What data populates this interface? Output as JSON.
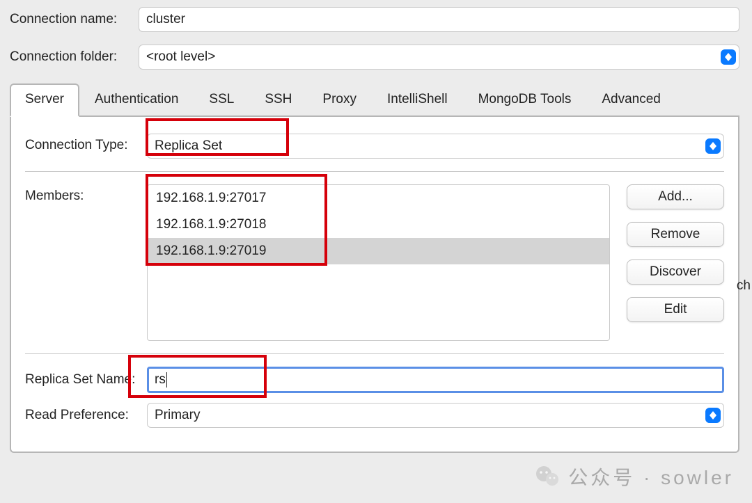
{
  "top": {
    "connection_name_label": "Connection name:",
    "connection_name_value": "cluster",
    "connection_folder_label": "Connection folder:",
    "connection_folder_value": "<root level>"
  },
  "tabs": {
    "server": "Server",
    "authentication": "Authentication",
    "ssl": "SSL",
    "ssh": "SSH",
    "proxy": "Proxy",
    "intellishell": "IntelliShell",
    "mongodb_tools": "MongoDB Tools",
    "advanced": "Advanced"
  },
  "server": {
    "connection_type_label": "Connection Type:",
    "connection_type_value": "Replica Set",
    "members_label": "Members:",
    "members": [
      "192.168.1.9:27017",
      "192.168.1.9:27018",
      "192.168.1.9:27019"
    ],
    "selected_member_index": 2,
    "buttons": {
      "add": "Add...",
      "remove": "Remove",
      "discover": "Discover",
      "edit": "Edit"
    },
    "replica_set_name_label": "Replica Set Name:",
    "replica_set_name_value": "rs",
    "read_preference_label": "Read Preference:",
    "read_preference_value": "Primary"
  },
  "watermark": {
    "text": "公众号 · sowler"
  },
  "cropped": {
    "ch": "ch"
  },
  "colors": {
    "accent": "#0a7aff",
    "focus_ring": "#5a8fe6",
    "annotation_red": "#d5000a"
  }
}
